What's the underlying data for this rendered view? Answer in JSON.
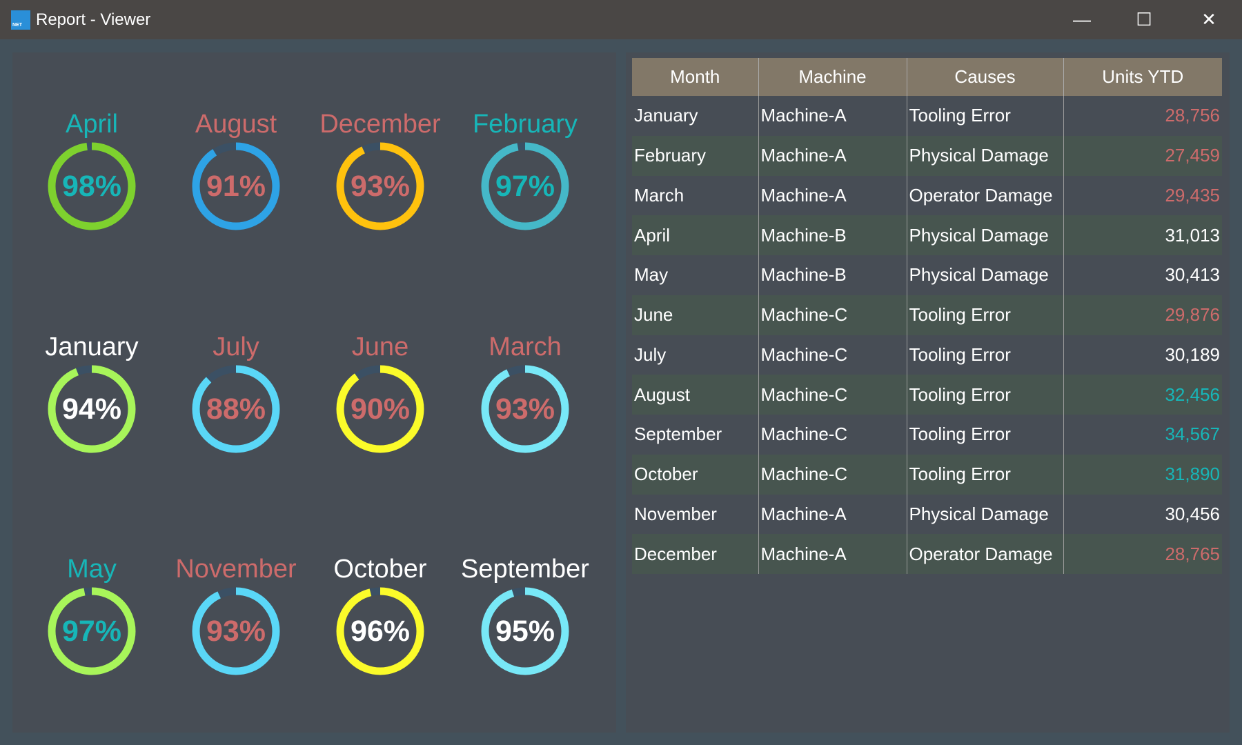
{
  "window": {
    "title": "Report - Viewer",
    "logo_text": "NET",
    "minimize": "—",
    "maximize": "☐",
    "close": "✕"
  },
  "colors": {
    "teal": "#17b6b8",
    "red": "#cd6b6b",
    "white": "#ffffff",
    "track": "#3b5064"
  },
  "gauges": [
    {
      "month": "April",
      "value": 98,
      "label": "98%",
      "color": "#7ed12e",
      "text": "teal"
    },
    {
      "month": "August",
      "value": 91,
      "label": "91%",
      "color": "#2ea3e6",
      "text": "red"
    },
    {
      "month": "December",
      "value": 93,
      "label": "93%",
      "color": "#ffc20e",
      "text": "red"
    },
    {
      "month": "February",
      "value": 97,
      "label": "97%",
      "color": "#45b8c8",
      "text": "teal"
    },
    {
      "month": "January",
      "value": 94,
      "label": "94%",
      "color": "#a8f55a",
      "text": "white"
    },
    {
      "month": "July",
      "value": 88,
      "label": "88%",
      "color": "#5ad7f7",
      "text": "red"
    },
    {
      "month": "June",
      "value": 90,
      "label": "90%",
      "color": "#fbfb2a",
      "text": "red"
    },
    {
      "month": "March",
      "value": 93,
      "label": "93%",
      "color": "#78e8f7",
      "text": "red"
    },
    {
      "month": "May",
      "value": 97,
      "label": "97%",
      "color": "#a8f55a",
      "text": "teal"
    },
    {
      "month": "November",
      "value": 93,
      "label": "93%",
      "color": "#5ad7f7",
      "text": "red"
    },
    {
      "month": "October",
      "value": 96,
      "label": "96%",
      "color": "#fbfb2a",
      "text": "white"
    },
    {
      "month": "September",
      "value": 95,
      "label": "95%",
      "color": "#78e8f7",
      "text": "white"
    }
  ],
  "table": {
    "headers": [
      "Month",
      "Machine",
      "Causes",
      "Units YTD"
    ],
    "rows": [
      {
        "month": "January",
        "machine": "Machine-A",
        "cause": "Tooling Error",
        "units": "28,756",
        "tone": "red"
      },
      {
        "month": "February",
        "machine": "Machine-A",
        "cause": "Physical Damage",
        "units": "27,459",
        "tone": "red"
      },
      {
        "month": "March",
        "machine": "Machine-A",
        "cause": "Operator Damage",
        "units": "29,435",
        "tone": "red"
      },
      {
        "month": "April",
        "machine": "Machine-B",
        "cause": "Physical Damage",
        "units": "31,013",
        "tone": "white"
      },
      {
        "month": "May",
        "machine": "Machine-B",
        "cause": "Physical Damage",
        "units": "30,413",
        "tone": "white"
      },
      {
        "month": "June",
        "machine": "Machine-C",
        "cause": "Tooling Error",
        "units": "29,876",
        "tone": "red"
      },
      {
        "month": "July",
        "machine": "Machine-C",
        "cause": "Tooling Error",
        "units": "30,189",
        "tone": "white"
      },
      {
        "month": "August",
        "machine": "Machine-C",
        "cause": "Tooling Error",
        "units": "32,456",
        "tone": "teal"
      },
      {
        "month": "September",
        "machine": "Machine-C",
        "cause": "Tooling Error",
        "units": "34,567",
        "tone": "teal"
      },
      {
        "month": "October",
        "machine": "Machine-C",
        "cause": "Tooling Error",
        "units": "31,890",
        "tone": "teal"
      },
      {
        "month": "November",
        "machine": "Machine-A",
        "cause": "Physical Damage",
        "units": "30,456",
        "tone": "white"
      },
      {
        "month": "December",
        "machine": "Machine-A",
        "cause": "Operator Damage",
        "units": "28,765",
        "tone": "red"
      }
    ]
  }
}
